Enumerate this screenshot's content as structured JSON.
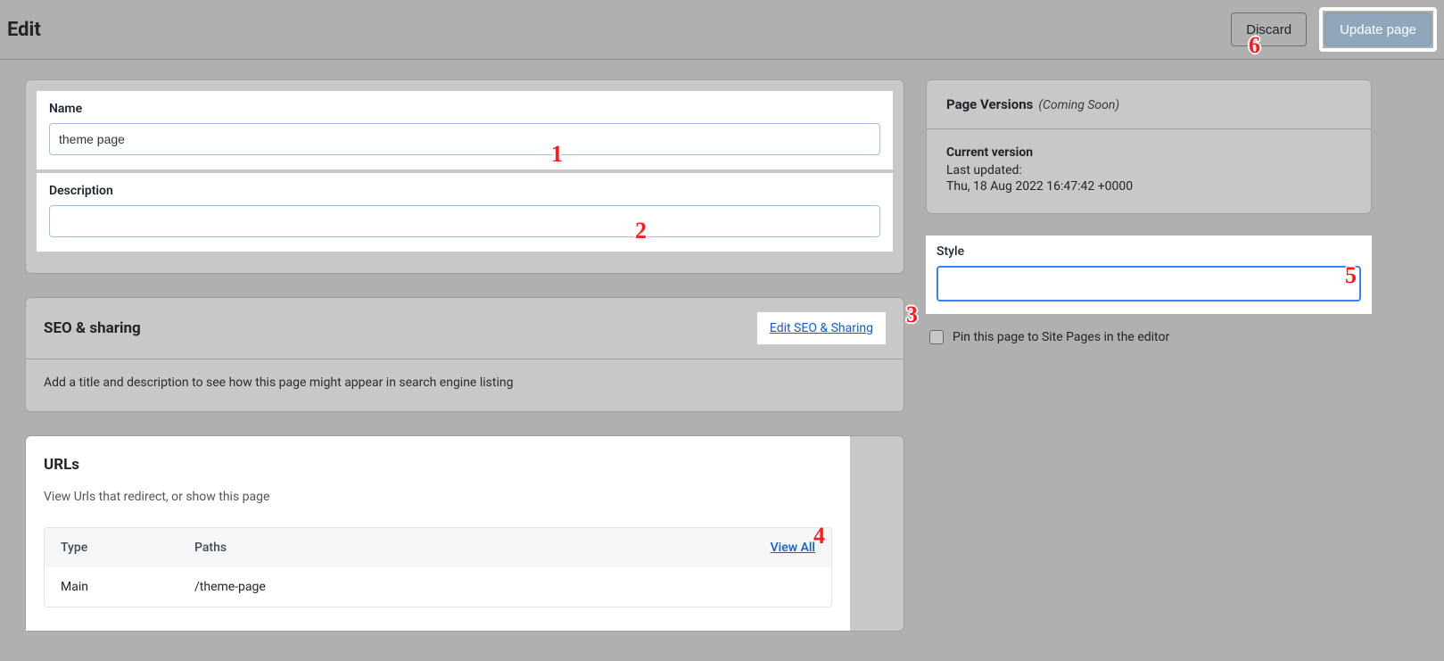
{
  "header": {
    "title": "Edit",
    "discard_label": "Discard",
    "update_label": "Update page"
  },
  "form": {
    "name_label": "Name",
    "name_value": "theme page",
    "description_label": "Description",
    "description_value": ""
  },
  "seo": {
    "heading": "SEO & sharing",
    "edit_link": "Edit SEO & Sharing",
    "note": "Add a title and description to see how this page might appear in search engine listing"
  },
  "urls": {
    "heading": "URLs",
    "subtext": "View Urls that redirect, or show this page",
    "columns": {
      "type": "Type",
      "paths": "Paths"
    },
    "view_all": "View All",
    "rows": [
      {
        "type": "Main",
        "path": "/theme-page"
      }
    ]
  },
  "versions": {
    "heading": "Page Versions",
    "coming_soon": "(Coming Soon)",
    "current_label": "Current version",
    "last_updated_label": "Last updated:",
    "last_updated_value": "Thu, 18 Aug 2022 16:47:42 +0000"
  },
  "style": {
    "label": "Style",
    "value": ""
  },
  "pin": {
    "label": "Pin this page to Site Pages in the editor",
    "checked": false
  },
  "annotations": [
    "1",
    "2",
    "3",
    "4",
    "5",
    "6"
  ]
}
